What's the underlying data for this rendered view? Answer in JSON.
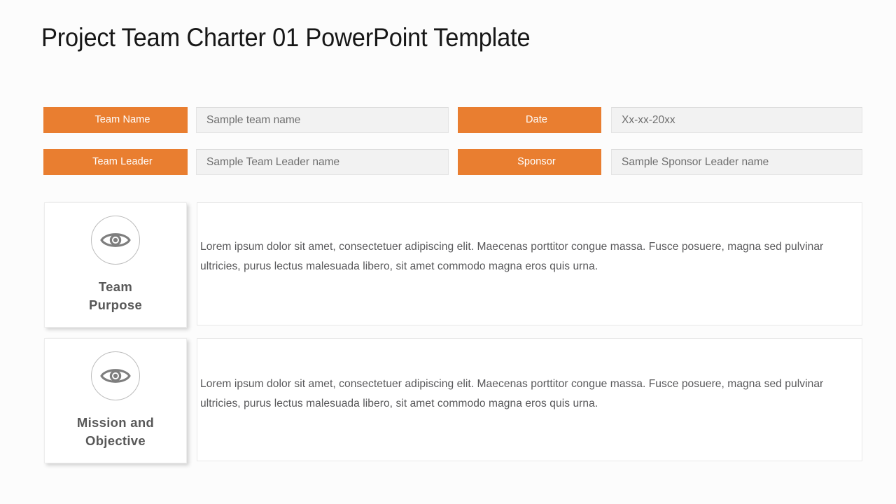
{
  "slide": {
    "title": "Project Team Charter 01 PowerPoint Template",
    "accent_color": "#E97E30",
    "background_color": "#FCFCFC",
    "text_color": "#58585A"
  },
  "form": {
    "fields": [
      {
        "label": "Team Name",
        "value": "Sample team name"
      },
      {
        "label": "Date",
        "value": "Xx-xx-20xx"
      },
      {
        "label": "Team Leader",
        "value": "Sample Team Leader name"
      },
      {
        "label": "Sponsor",
        "value": "Sample Sponsor Leader name"
      }
    ]
  },
  "sections": [
    {
      "icon": "eye-icon",
      "label_line1": "Team",
      "label_line2": "Purpose",
      "body": "Lorem ipsum dolor sit amet, consectetuer adipiscing elit. Maecenas porttitor congue massa. Fusce posuere, magna sed pulvinar ultricies, purus lectus malesuada libero, sit amet commodo magna eros quis urna."
    },
    {
      "icon": "eye-icon",
      "label_line1": "Mission and",
      "label_line2": "Objective",
      "body": "Lorem ipsum dolor sit amet, consectetuer adipiscing elit. Maecenas porttitor congue massa. Fusce posuere, magna sed pulvinar ultricies, purus lectus malesuada libero, sit amet commodo magna eros quis urna."
    }
  ]
}
